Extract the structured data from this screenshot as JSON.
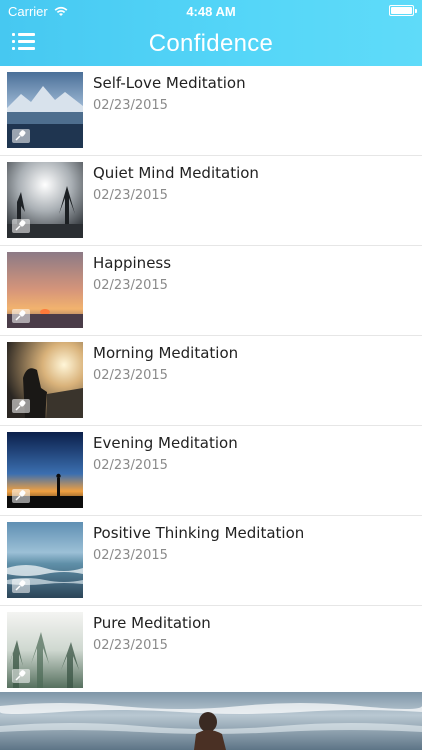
{
  "status_bar": {
    "carrier": "Carrier",
    "time": "4:48 AM"
  },
  "header": {
    "title": "Confidence",
    "menu_icon": "menu-list-icon"
  },
  "colors": {
    "header_start": "#46c8f1",
    "header_end": "#5fdbf9",
    "title_text": "#222222",
    "date_text": "#8a8a8a"
  },
  "items": [
    {
      "title": "Self-Love Meditation",
      "date": "02/23/2015",
      "thumbnail": "mountain-lake"
    },
    {
      "title": "Quiet Mind Meditation",
      "date": "02/23/2015",
      "thumbnail": "misty-forest"
    },
    {
      "title": "Happiness",
      "date": "02/23/2015",
      "thumbnail": "sunset-sky"
    },
    {
      "title": "Morning Meditation",
      "date": "02/23/2015",
      "thumbnail": "morning-sun"
    },
    {
      "title": "Evening Meditation",
      "date": "02/23/2015",
      "thumbnail": "dusk-silhouette"
    },
    {
      "title": "Positive Thinking Meditation",
      "date": "02/23/2015",
      "thumbnail": "ocean-waves"
    },
    {
      "title": "Pure Meditation",
      "date": "02/23/2015",
      "thumbnail": "foggy-trees"
    }
  ],
  "badge_icon": "microphone-icon",
  "footer_image": "beach-waves-photo"
}
